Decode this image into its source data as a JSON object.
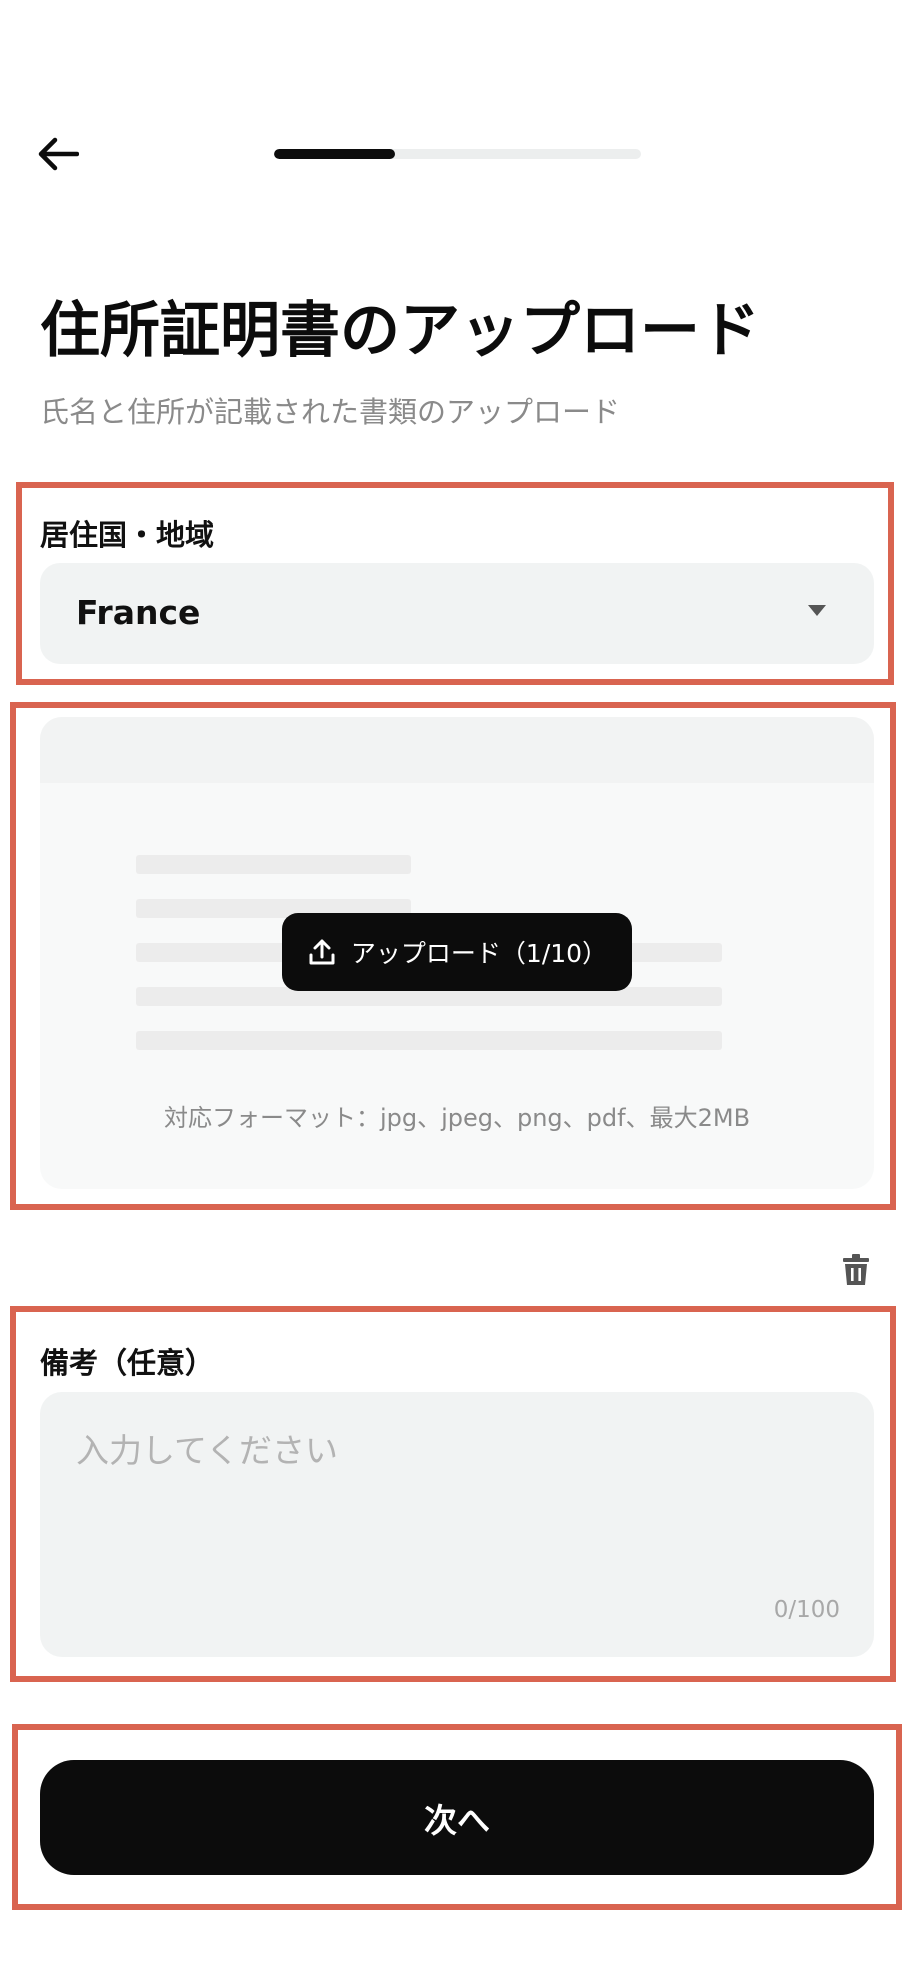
{
  "header": {
    "back_icon": "arrow-left-icon",
    "progress_fraction": 0.33
  },
  "page": {
    "title": "住所証明書のアップロード",
    "subtitle": "氏名と住所が記載された書類のアップロード"
  },
  "country": {
    "label": "居住国・地域",
    "value": "France",
    "caret_icon": "caret-down-icon"
  },
  "upload": {
    "button_label": "アップロード（1/10）",
    "button_icon": "upload-icon",
    "formats_text": "対応フォーマット：jpg、jpeg、png、pdf、最大2MB",
    "delete_icon": "trash-icon"
  },
  "notes": {
    "label": "備考（任意）",
    "placeholder": "入力してください",
    "value": "",
    "counter": "0/100"
  },
  "actions": {
    "next_label": "次へ"
  },
  "colors": {
    "primary": "#0c0c0c",
    "field_bg": "#f1f3f3",
    "progress_track": "#eceeee",
    "highlight_frame": "#d96450",
    "muted_text": "#8a8a8a"
  }
}
